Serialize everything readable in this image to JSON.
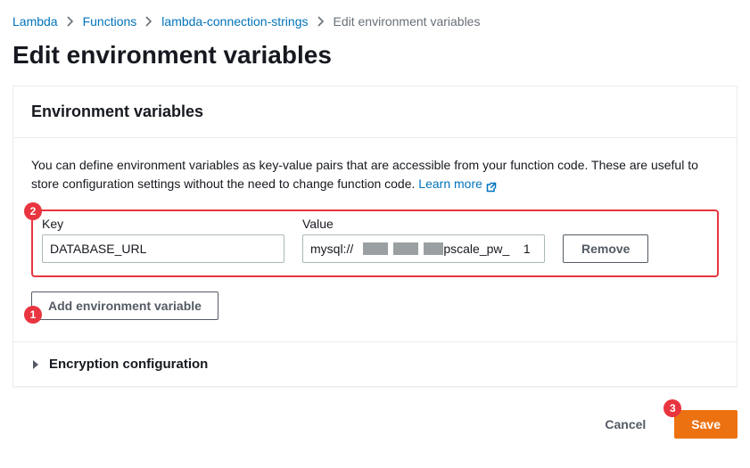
{
  "breadcrumb": {
    "items": [
      "Lambda",
      "Functions",
      "lambda-connection-strings"
    ],
    "current": "Edit environment variables"
  },
  "page": {
    "title": "Edit environment variables"
  },
  "panel": {
    "header": "Environment variables",
    "helptext_a": "You can define environment variables as key-value pairs that are accessible from your function code. These are useful to store configuration settings without the need to change function code. ",
    "learn_more": "Learn more",
    "labels": {
      "key": "Key",
      "value": "Value"
    },
    "row": {
      "key": "DATABASE_URL",
      "value_display": "mysql://                         :pscale_pw_    1",
      "remove": "Remove"
    },
    "add_button": "Add environment variable",
    "encryption_section": "Encryption configuration"
  },
  "footer": {
    "cancel": "Cancel",
    "save": "Save"
  },
  "callouts": {
    "c1": "1",
    "c2": "2",
    "c3": "3"
  }
}
